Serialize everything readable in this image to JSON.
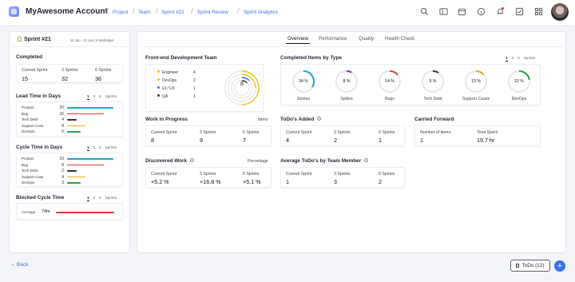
{
  "header": {
    "account": "MyAwesome Account",
    "breadcrumbs": [
      "Project",
      "Team",
      "Sprint #21",
      "Sprint Review",
      "Sprint Analytics"
    ]
  },
  "left": {
    "sprint": "Sprint #21",
    "dates": "15 Jan - 21 Jan | 5 Workdays",
    "completed": {
      "title": "Completed",
      "labels": [
        "Current Sprint",
        "3 Sprints",
        "6 Sprints"
      ],
      "values": [
        "15",
        "32",
        "36"
      ]
    },
    "lead": {
      "title": "Lead Time in Days",
      "toggle": [
        "1",
        "3",
        "6",
        "Sprints"
      ],
      "rows": [
        {
          "label": "Product",
          "value": "20",
          "color": "#1aa9c4",
          "frac": 1.0
        },
        {
          "label": "Bug",
          "value": "16",
          "color": "#e03c3c",
          "frac": 0.8
        },
        {
          "label": "Tech Debt",
          "value": "4",
          "color": "#333333",
          "frac": 0.2
        },
        {
          "label": "Support Case",
          "value": "8",
          "color": "#f0a81e",
          "frac": 0.4
        },
        {
          "label": "DevOps",
          "value": "6",
          "color": "#2e9a4b",
          "frac": 0.3
        }
      ]
    },
    "cycle": {
      "title": "Cycle Time in Days",
      "toggle": [
        "1",
        "3",
        "6",
        "Sprints"
      ],
      "rows": [
        {
          "label": "Product",
          "value": "10",
          "color": "#1aa9c4",
          "frac": 1.0
        },
        {
          "label": "Bug",
          "value": "8",
          "color": "#e03c3c",
          "frac": 0.8
        },
        {
          "label": "Tech Debt",
          "value": "2",
          "color": "#333333",
          "frac": 0.2
        },
        {
          "label": "Support Case",
          "value": "4",
          "color": "#f0a81e",
          "frac": 0.4
        },
        {
          "label": "DevOps",
          "value": "3",
          "color": "#2e9a4b",
          "frac": 0.3
        }
      ]
    },
    "blocked": {
      "title": "Blocked Cycle Time",
      "toggle": [
        "1",
        "3",
        "6",
        "Sprints"
      ],
      "label": "Average",
      "value": "74hr",
      "color": "#e03c3c"
    }
  },
  "tabs": [
    "Overview",
    "Performance",
    "Quality",
    "Health Check"
  ],
  "frontend": {
    "title": "Front-end Development Team",
    "members": [
      {
        "role": "Engineer",
        "count": "4",
        "color": "#f0c419"
      },
      {
        "role": "DevOps",
        "count": "2",
        "color": "#f0c419"
      },
      {
        "role": "UI / UX",
        "count": "1",
        "color": "#3a6ff0"
      },
      {
        "role": "QA",
        "count": "1",
        "color": "#333333"
      }
    ],
    "total": "8"
  },
  "types": {
    "title": "Completed Items by Type",
    "toggle": [
      "1",
      "3",
      "6",
      "Sprints"
    ],
    "items": [
      {
        "label": "Stories",
        "pct": "34 %",
        "value": 34,
        "color": "#1aa9c4"
      },
      {
        "label": "Spikes",
        "pct": "8 %",
        "value": 8,
        "color": "#7b3fb8"
      },
      {
        "label": "Bugs",
        "pct": "14 %",
        "value": 14,
        "color": "#e03c3c"
      },
      {
        "label": "Tech Debt",
        "pct": "9 %",
        "value": 9,
        "color": "#333333"
      },
      {
        "label": "Support Cases",
        "pct": "13 %",
        "value": 13,
        "color": "#f0a81e"
      },
      {
        "label": "DevOps",
        "pct": "22 %",
        "value": 22,
        "color": "#2e9a4b"
      }
    ]
  },
  "wip": {
    "title": "Work in Progress",
    "unit": "Items",
    "labels": [
      "Current Sprint",
      "3 Sprints",
      "6 Sprints"
    ],
    "values": [
      "8",
      "9",
      "7"
    ]
  },
  "todos": {
    "title": "ToDo's Added",
    "labels": [
      "Current Sprint",
      "3 Sprints",
      "6 Sprints"
    ],
    "values": [
      "4",
      "2",
      "1"
    ]
  },
  "carried": {
    "title": "Carried Forward",
    "labels": [
      "Number of items:",
      "Time Spent"
    ],
    "values": [
      "1",
      "19.7 hr"
    ]
  },
  "discovered": {
    "title": "Discovered Work",
    "unit": "Percentage",
    "labels": [
      "Current Sprint",
      "3 Sprints",
      "6 Sprints"
    ],
    "values": [
      "+5.2 %",
      "+16.8 %",
      "+5.1 %"
    ]
  },
  "avgtodo": {
    "title": "Average ToDo's by Team Member",
    "labels": [
      "Current Sprint",
      "3 Sprints",
      "6 Sprints"
    ],
    "values": [
      "1",
      "3",
      "2"
    ]
  },
  "footer": {
    "back": "Back",
    "todo": "ToDo (12)",
    "add": "+"
  }
}
